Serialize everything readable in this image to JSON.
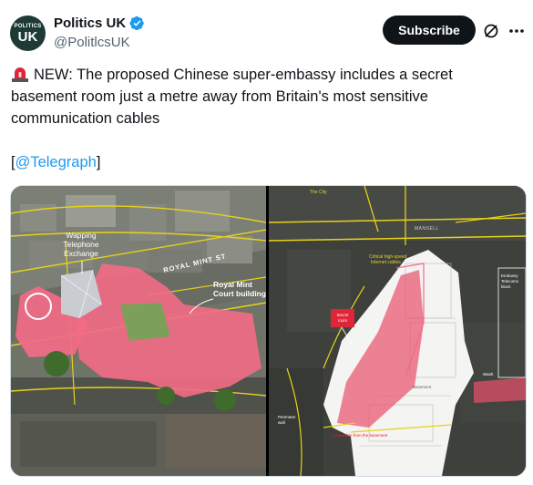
{
  "account": {
    "display_name": "Politics UK",
    "handle": "@PolitlcsUK",
    "avatar_line1": "POLITICS",
    "avatar_line2": "UK"
  },
  "actions": {
    "subscribe_label": "Subscribe"
  },
  "tweet": {
    "new_label": "NEW:",
    "body": " The proposed Chinese super-embassy includes a secret basement room just a metre away from Britain's most sensitive communication cables",
    "bracket_open": "[",
    "link_text": "@Telegraph",
    "bracket_close": "]"
  },
  "media": {
    "left_labels": {
      "wapping_1": "Wapping",
      "wapping_2": "Telephone",
      "wapping_3": "Exchange",
      "street": "ROYAL MINT ST",
      "mint_1": "Royal Mint",
      "mint_2": "Court buildings"
    },
    "right_labels": {
      "city": "The City",
      "mansell": "MANSELL",
      "cables_1": "Critical high-speed",
      "cables_2": "Internet cables",
      "secret_1": "Secret",
      "secret_2": "room",
      "perimeter_1": "Perimeter",
      "perimeter_2": "wall",
      "embassy_1": "Embassy",
      "embassy_2": "Telecoms",
      "embassy_3": "block",
      "wash": "Wash",
      "basement": "Basement",
      "bottom": "Accessible from the basement"
    }
  },
  "colors": {
    "verified": "#1d9bf0",
    "link": "#1d9bf0",
    "subscribe_bg": "#0f1419",
    "highlight_pink": "#f26b85",
    "cable_yellow": "#e5d21a",
    "secret_red": "#e0243a"
  }
}
